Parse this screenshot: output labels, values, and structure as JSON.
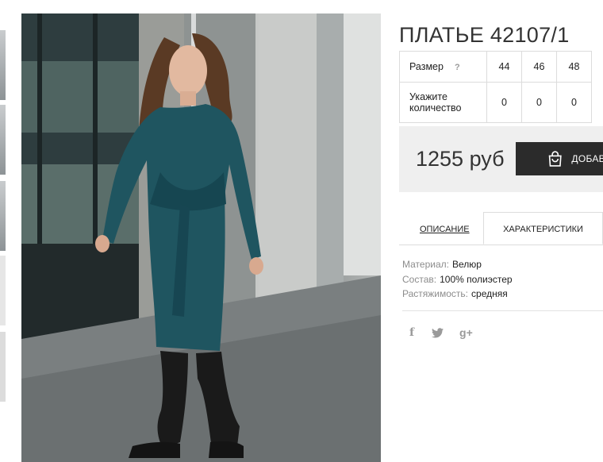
{
  "product": {
    "title": "ПЛАТЬЕ 42107/1"
  },
  "sizes": {
    "size_label": "Размер",
    "help_mark": "?",
    "sizes": [
      "44",
      "46",
      "48"
    ],
    "quantity_label": "Укажите количество",
    "quantities": [
      "0",
      "0",
      "0"
    ]
  },
  "purchase": {
    "price": "1255 руб",
    "cart_label": "ДОБАВ"
  },
  "tabs": [
    {
      "label": "ОПИСАНИЕ",
      "active": false
    },
    {
      "label": "ХАРАКТЕРИСТИКИ",
      "active": true
    }
  ],
  "specs": [
    {
      "key": "Материал:",
      "value": "Велюр"
    },
    {
      "key": "Состав:",
      "value": "100% полиэстер"
    },
    {
      "key": "Растяжимость:",
      "value": "средняя"
    }
  ],
  "social": {
    "facebook": "f",
    "twitter": "twitter-icon",
    "gplus": "g+"
  },
  "colors": {
    "dress": "#1f5560",
    "cart_button": "#2b2b2b",
    "panel": "#efefef"
  }
}
